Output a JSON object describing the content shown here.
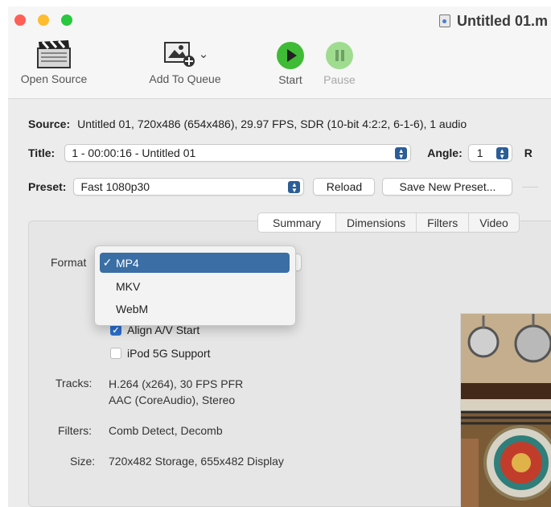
{
  "window": {
    "title": "Untitled 01.m"
  },
  "toolbar": {
    "open_source": "Open Source",
    "add_to_queue": "Add To Queue",
    "start": "Start",
    "pause": "Pause"
  },
  "source": {
    "label": "Source:",
    "value": "Untitled 01, 720x486 (654x486), 29.97 FPS, SDR (10-bit 4:2:2, 6-1-6), 1 audio"
  },
  "title_row": {
    "label": "Title:",
    "value": "1 - 00:00:16 - Untitled 01",
    "angle_label": "Angle:",
    "angle_value": "1",
    "range_label": "R"
  },
  "preset_row": {
    "label": "Preset:",
    "value": "Fast 1080p30",
    "reload": "Reload",
    "save_new": "Save New Preset..."
  },
  "tabs": [
    "Summary",
    "Dimensions",
    "Filters",
    "Video"
  ],
  "summary": {
    "format_label": "Format",
    "align_av": "Align A/V Start",
    "ipod": "iPod 5G Support",
    "tracks_label": "Tracks:",
    "tracks_line1": "H.264 (x264), 30 FPS PFR",
    "tracks_line2": "AAC (CoreAudio), Stereo",
    "filters_label": "Filters:",
    "filters_value": "Comb Detect, Decomb",
    "size_label": "Size:",
    "size_value": "720x482 Storage, 655x482 Display"
  },
  "format_menu": {
    "items": [
      "MP4",
      "MKV",
      "WebM"
    ],
    "selected_mark": "✓"
  },
  "colors": {
    "close": "#ff5f57",
    "minimize": "#febc2e",
    "zoom": "#28c840",
    "accent": "#3a6ea5",
    "start": "#3fbb36",
    "pause": "#9fdc8f"
  }
}
